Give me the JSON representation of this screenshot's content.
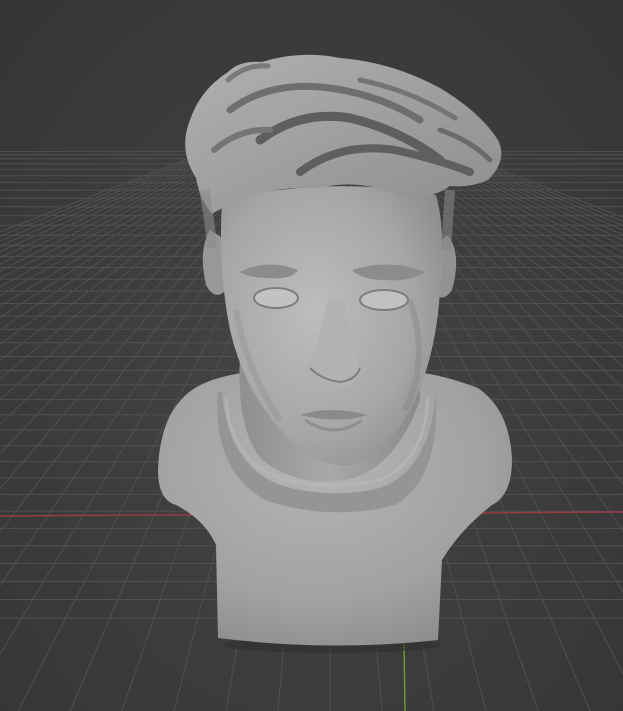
{
  "viewport": {
    "background_color": "#3d3d3d",
    "grid_color": "#505050",
    "x_axis_color": "#9a3a45",
    "y_axis_color": "#6a9a2a"
  },
  "scene": {
    "object": "sculpted-bust-icon",
    "material_color": "#a6a6a6"
  }
}
